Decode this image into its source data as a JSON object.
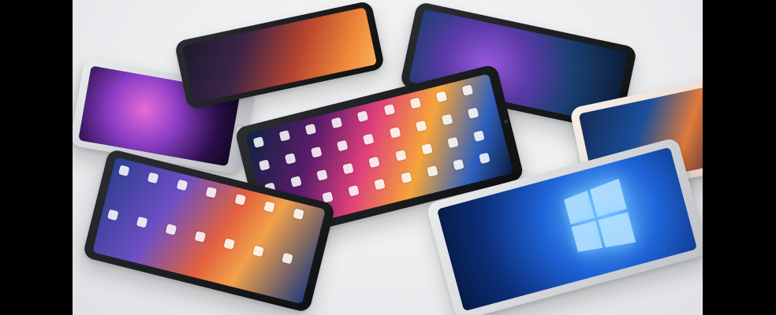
{
  "scene": {
    "subject": "tablets",
    "palette": {
      "table": "#eceef0",
      "letterbox": "#000000",
      "bezel_dark": "#1a1b1e",
      "bezel_silver": "#d6d8db",
      "bezel_gold": "#f1e4dc",
      "windows_blue": "#1e63d6"
    }
  }
}
